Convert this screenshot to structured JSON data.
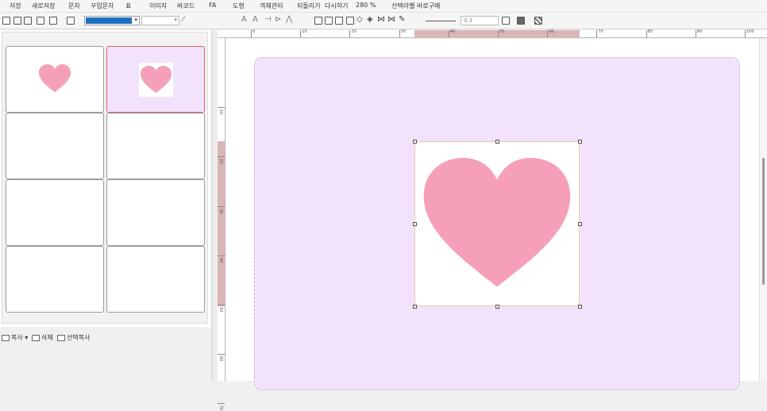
{
  "menu": {
    "save": "저장",
    "save_as": "새로저장",
    "text": "문자",
    "deco_text": "꾸밈문자",
    "table": "표",
    "image": "이미지",
    "barcode": "바코드",
    "fa": "FA",
    "shape": "도형",
    "object_manage": "객체관리",
    "undo": "되돌리기",
    "redo": "다시하기",
    "zoom": "280 %",
    "buy_label": "선택라벨 바로구매"
  },
  "toolbar": {
    "fill_color": "#1e6fc1",
    "line_width": "0.3"
  },
  "ruler_top": {
    "labels": [
      "0",
      "10",
      "20",
      "30",
      "40",
      "50",
      "60",
      "70",
      "80",
      "90",
      "100"
    ]
  },
  "ruler_left": {
    "labels": [
      "10",
      "20",
      "30",
      "40",
      "50",
      "60",
      "70"
    ]
  },
  "panel": {
    "copy": "복사",
    "delete": "삭제",
    "select_copy": "선택복사"
  },
  "colors": {
    "heart": "#f5a0b8",
    "page_bg": "#f3e2fc",
    "selected_border": "#e06070"
  }
}
